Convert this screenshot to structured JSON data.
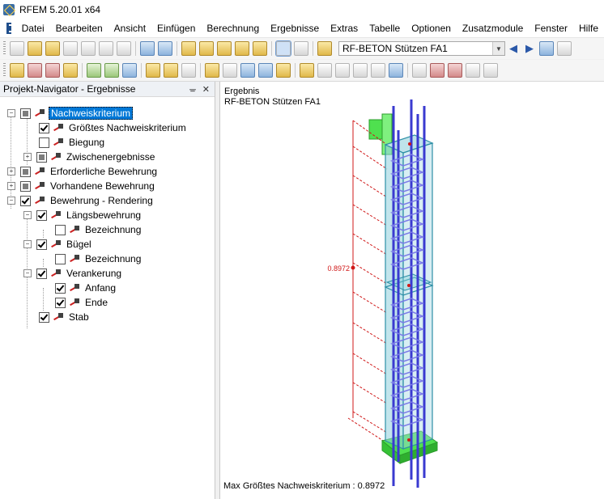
{
  "window": {
    "title": "RFEM 5.20.01 x64"
  },
  "menu": [
    "Datei",
    "Bearbeiten",
    "Ansicht",
    "Einfügen",
    "Berechnung",
    "Ergebnisse",
    "Extras",
    "Tabelle",
    "Optionen",
    "Zusatzmodule",
    "Fenster",
    "Hilfe"
  ],
  "toolbar": {
    "case_combo": "RF-BETON Stützen FA1"
  },
  "navigator": {
    "title": "Projekt-Navigator - Ergebnisse",
    "pin": "ᚚ",
    "close": "✕",
    "items": [
      {
        "label": "Nachweiskriterium",
        "state": "partial",
        "selected": true
      },
      {
        "label": "Größtes Nachweiskriterium",
        "state": "checked"
      },
      {
        "label": "Biegung",
        "state": "unchecked"
      },
      {
        "label": "Zwischenergebnisse",
        "state": "partial"
      },
      {
        "label": "Erforderliche Bewehrung",
        "state": "partial"
      },
      {
        "label": "Vorhandene Bewehrung",
        "state": "partial"
      },
      {
        "label": "Bewehrung - Rendering",
        "state": "checked"
      },
      {
        "label": "Längsbewehrung",
        "state": "checked"
      },
      {
        "label": "Bezeichnung",
        "state": "unchecked"
      },
      {
        "label": "Bügel",
        "state": "checked"
      },
      {
        "label": "Bezeichnung",
        "state": "unchecked"
      },
      {
        "label": "Verankerung",
        "state": "checked"
      },
      {
        "label": "Anfang",
        "state": "checked"
      },
      {
        "label": "Ende",
        "state": "checked"
      },
      {
        "label": "Stab",
        "state": "checked"
      }
    ]
  },
  "view": {
    "result_label": "Ergebnis",
    "result_case": "RF-BETON Stützen FA1",
    "value_label": "0.8972",
    "footer": "Max Größtes Nachweiskriterium : 0.8972",
    "colors": {
      "column": "#5bb3c6",
      "rebar": "#3a3ad0",
      "support": "#4fe04f",
      "diagram": "#d01818"
    }
  }
}
